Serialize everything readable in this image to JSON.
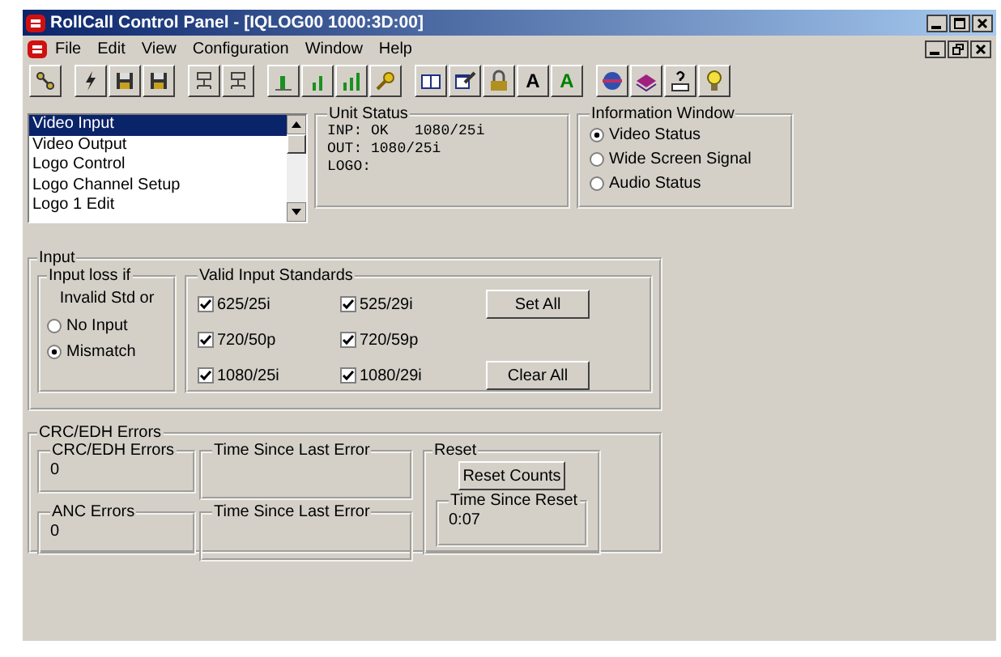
{
  "window": {
    "title": "RollCall Control Panel - [IQLOG00 1000:3D:00]"
  },
  "menu": [
    "File",
    "Edit",
    "View",
    "Configuration",
    "Window",
    "Help"
  ],
  "toolbar": [
    [
      {
        "kind": "plug"
      }
    ],
    [
      {
        "kind": "bolt"
      },
      {
        "kind": "disk"
      },
      {
        "kind": "disk"
      }
    ],
    [
      {
        "kind": "network"
      },
      {
        "kind": "network"
      }
    ],
    [
      {
        "kind": "bars1"
      },
      {
        "kind": "bars2"
      },
      {
        "kind": "bars3"
      },
      {
        "kind": "key"
      }
    ],
    [
      {
        "kind": "book"
      },
      {
        "kind": "edit"
      },
      {
        "kind": "lock"
      },
      {
        "kind": "letter",
        "label": "A",
        "color": "#000000"
      },
      {
        "kind": "letter",
        "label": "A",
        "color": "#008000"
      }
    ],
    [
      {
        "kind": "globe"
      },
      {
        "kind": "stack"
      },
      {
        "kind": "help"
      },
      {
        "kind": "bulb"
      }
    ]
  ],
  "nav_list": [
    {
      "label": "Video Input",
      "selected": true
    },
    {
      "label": "Video Output",
      "selected": false
    },
    {
      "label": "Logo Control",
      "selected": false
    },
    {
      "label": "Logo Channel Setup",
      "selected": false
    },
    {
      "label": "Logo 1 Edit",
      "selected": false
    }
  ],
  "unit_status": {
    "title": "Unit Status",
    "lines": [
      "INP: OK   1080/25i",
      "OUT: 1080/25i",
      "LOGO:"
    ]
  },
  "information_window": {
    "title": "Information Window",
    "options": [
      {
        "label": "Video Status",
        "selected": true
      },
      {
        "label": "Wide Screen Signal",
        "selected": false
      },
      {
        "label": "Audio Status",
        "selected": false
      }
    ]
  },
  "input": {
    "title": "Input",
    "loss": {
      "title": "Input  loss if",
      "caption": "Invalid Std or",
      "options": [
        {
          "label": "No Input",
          "selected": false
        },
        {
          "label": "Mismatch",
          "selected": true
        }
      ]
    },
    "standards": {
      "title": "Valid Input Standards",
      "items": [
        {
          "label": "625/25i",
          "checked": true
        },
        {
          "label": "525/29i",
          "checked": true
        },
        {
          "label": "720/50p",
          "checked": true
        },
        {
          "label": "720/59p",
          "checked": true
        },
        {
          "label": "1080/25i",
          "checked": true
        },
        {
          "label": "1080/29i",
          "checked": true
        }
      ],
      "buttons": [
        "Set All",
        "Clear All"
      ]
    }
  },
  "crc": {
    "title": "CRC/EDH Errors",
    "counters": [
      {
        "title": "CRC/EDH Errors",
        "value": "0",
        "time_title": "Time Since Last Error"
      },
      {
        "title": "ANC Errors",
        "value": "0",
        "time_title": "Time Since Last Error"
      }
    ],
    "reset": {
      "title": "Reset",
      "button": "Reset Counts",
      "time_title": "Time Since Reset",
      "time_value": "0:07"
    }
  }
}
